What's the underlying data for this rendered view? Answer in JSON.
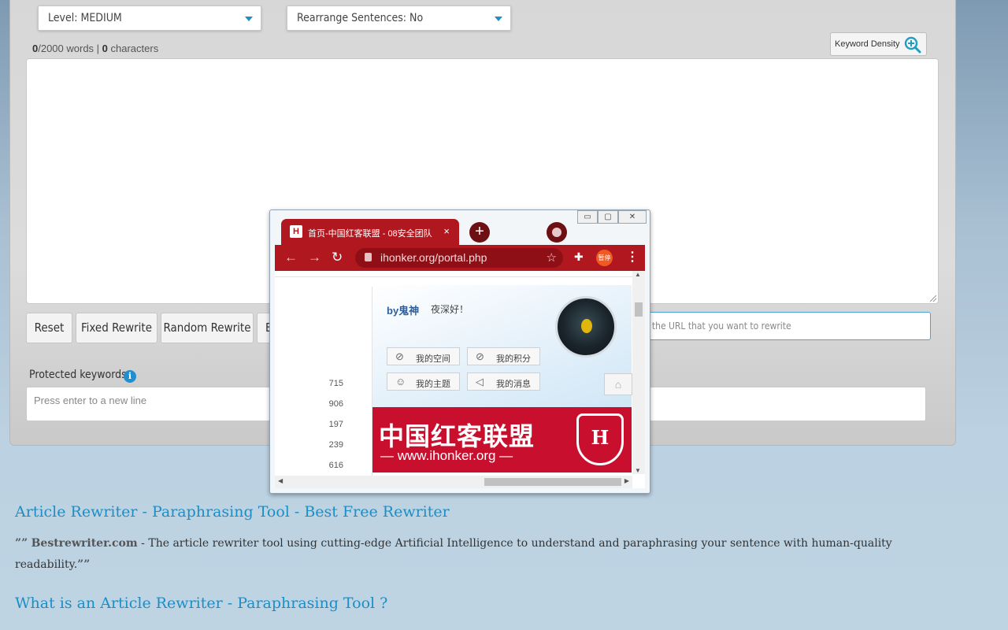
{
  "form": {
    "level_select": "Level:  MEDIUM",
    "rearrange_select": "Rearrange Sentences:  No",
    "word_count": "0",
    "word_limit": "/2000 words | ",
    "char_count": "0",
    "char_suffix": " characters",
    "keyword_density_button": "Keyword Density",
    "buttons": {
      "reset": "Reset",
      "fixed": "Fixed Rewrite",
      "random": "Random Rewrite",
      "partial": "B"
    },
    "url_placeholder": "r the URL that you want to rewrite",
    "protected_label": "Protected keywords",
    "protected_placeholder": "Press enter to a new line"
  },
  "article": {
    "heading1": "Article Rewriter - Paraphrasing Tool - Best Free Rewriter",
    "open_quote": "”",
    "site": "Bestrewriter.com",
    "body": " - The article rewriter tool using cutting-edge Artificial Intelligence to understand and paraphrasing your sentence with human-quality readability.",
    "close_quote": "”",
    "heading2": "What is an Article Rewriter - Paraphrasing Tool ?"
  },
  "popup": {
    "tab_title": "首页-中国红客联盟 - 08安全团队",
    "favicon": "H",
    "tab_close": "×",
    "new_tab": "+",
    "address": "ihonker.org/portal.php",
    "profile_badge": "暂停",
    "page": {
      "username": "by鬼神",
      "greeting": "夜深好！",
      "stats": [
        "715",
        "906",
        "197",
        "239",
        "616"
      ],
      "menu": [
        "我的空间",
        "我的积分",
        "我的主题",
        "我的消息"
      ],
      "banner_text": "中国红客联盟",
      "banner_url": "— www.ihonker.org —",
      "banner_shield": "H"
    }
  },
  "colors": {
    "accent_blue": "#1a8ec7",
    "browser_red": "#b1171f",
    "banner_red": "#c8102e"
  }
}
